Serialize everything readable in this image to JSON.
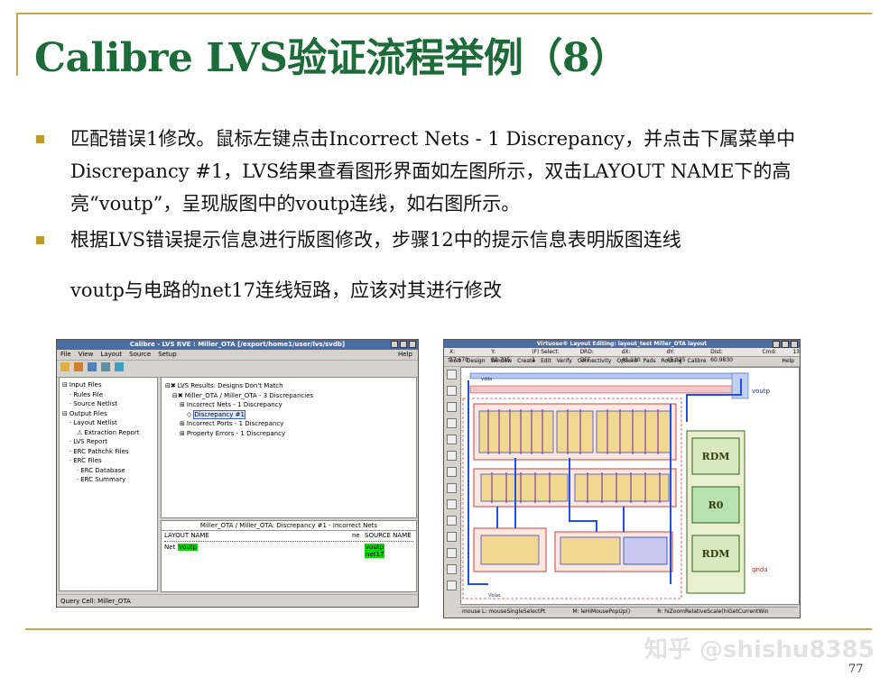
{
  "slide": {
    "title": "Calibre LVS验证流程举例（8）",
    "bullets": [
      "匹配错误1修改。鼠标左键点击Incorrect Nets - 1 Discrepancy，并点击下属菜单中Discrepancy #1，LVS结果查看图形界面如左图所示，双击LAYOUT NAME下的高亮“voutp”，呈现版图中的voutp连线，如右图所示。",
      "根据LVS错误提示信息进行版图修改，步骤12中的提示信息表明版图连线"
    ],
    "bullet_continuation": "voutp与电路的net17连线短路，应该对其进行修改",
    "watermark": "知乎 @shishu8385",
    "page_number": "77",
    "accent_color": "#c9a44a",
    "title_color": "#1e6b3a"
  },
  "rve": {
    "title": "Calibre - LVS RVE : Miller_OTA [/export/home1/user/lvs/svdb]",
    "menu": [
      "File",
      "View",
      "Layout",
      "Source",
      "Setup"
    ],
    "menu_help": "Help",
    "toolbar_icons": [
      "open-folder-icon",
      "pencil-icon",
      "highlight-icon",
      "settings-icon",
      "zoom-icon"
    ],
    "nav_tree": [
      {
        "label": "Input Files",
        "level": 0
      },
      {
        "label": "Rules File",
        "level": 1
      },
      {
        "label": "Source Netlist",
        "level": 1
      },
      {
        "label": "Output Files",
        "level": 0
      },
      {
        "label": "Layout Netlist",
        "level": 1
      },
      {
        "label": "Extraction Report",
        "level": 2
      },
      {
        "label": "LVS Report",
        "level": 1
      },
      {
        "label": "ERC Pathchk Files",
        "level": 1
      },
      {
        "label": "ERC Files",
        "level": 1
      },
      {
        "label": "ERC Database",
        "level": 2
      },
      {
        "label": "ERC Summary",
        "level": 2
      }
    ],
    "results_tree": [
      {
        "label": "LVS Results: Designs Don't Match",
        "level": 0
      },
      {
        "label": "Miller_OTA / Miller_OTA - 3 Discrepancies",
        "level": 1
      },
      {
        "label": "Incorrect Nets - 1 Discrepancy",
        "level": 2
      },
      {
        "label": "Discrepancy #1",
        "level": 3
      },
      {
        "label": "Incorrect Ports - 1 Discrepancy",
        "level": 2
      },
      {
        "label": "Property Errors - 1 Discrepancy",
        "level": 2
      }
    ],
    "detail_title": "Miller_OTA / Miller_OTA: Discrepancy #1 - Incorrect Nets",
    "col_layout": "LAYOUT NAME",
    "col_ne": "ne",
    "col_source": "SOURCE NAME",
    "net_label": "Net",
    "layout_net": "voutp",
    "source_net_1": "voutp",
    "source_net_2": "net17",
    "status": "Query Cell: Miller_OTA",
    "highlight_color": "#00e000",
    "titlebar_color": "#4b6ba3"
  },
  "virtuoso": {
    "title": "Virtuoso® Layout Editing: layout_test Miller_OTA layout",
    "coords": [
      "X: 77.670",
      "Y: 52.735",
      "(F) Select: 1",
      "DRD: OFF",
      "dX: 41.130",
      "dY: 45.025",
      "Dist: 60.9830",
      "Cmd:"
    ],
    "coord_right": "13",
    "menu": [
      "Tools",
      "Design",
      "Window",
      "Create",
      "Edit",
      "Verify",
      "Connectivity",
      "Options",
      "Pads",
      "Routing",
      "Calibre"
    ],
    "menu_help": "Help",
    "labels": {
      "rdm_top": "RDM",
      "r0": "R0",
      "rdm_bottom": "RDM",
      "voutp": "voutp",
      "gnda": "gnda",
      "vdd": "vdda",
      "bias": "Vbias"
    },
    "status": [
      "mouse L: mouseSingleSelectPt",
      "M: leHiMousePopUp()",
      "R: hiZoomRelativeScale(hiGetCurrentWin"
    ]
  }
}
